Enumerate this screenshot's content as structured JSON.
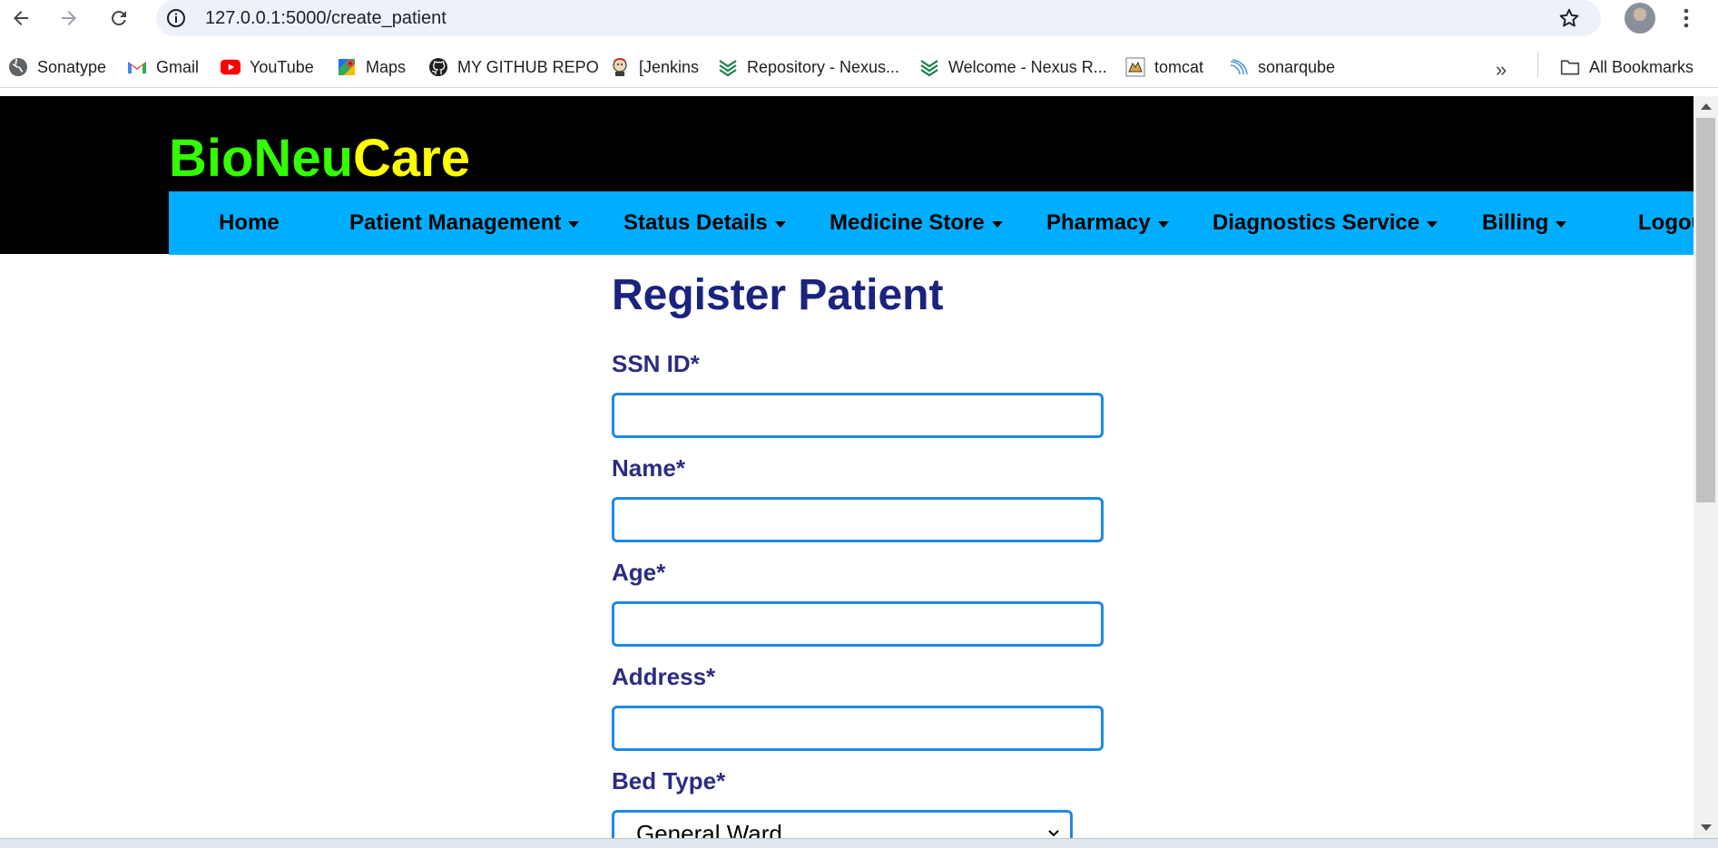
{
  "browser": {
    "url": "127.0.0.1:5000/create_patient",
    "bookmarks": [
      {
        "label": "Sonatype",
        "icon": "globe-icon"
      },
      {
        "label": "Gmail",
        "icon": "gmail-icon"
      },
      {
        "label": "YouTube",
        "icon": "youtube-icon"
      },
      {
        "label": "Maps",
        "icon": "maps-icon"
      },
      {
        "label": "MY GITHUB REPO",
        "icon": "github-icon"
      },
      {
        "label": "[Jenkins",
        "icon": "jenkins-icon"
      },
      {
        "label": "Repository - Nexus...",
        "icon": "nexus-icon"
      },
      {
        "label": "Welcome - Nexus R...",
        "icon": "nexus-icon"
      },
      {
        "label": "tomcat",
        "icon": "tomcat-icon"
      },
      {
        "label": "sonarqube",
        "icon": "sonarqube-icon"
      }
    ],
    "all_bookmarks_label": "All Bookmarks"
  },
  "site": {
    "brand_part1": "BioNeu",
    "brand_part2": "Care",
    "brand_color1": "#33ff00",
    "brand_color2": "#ffff00",
    "menu_color": "#00aeff",
    "nav": [
      {
        "label": "Home",
        "dropdown": false
      },
      {
        "label": "Patient Management",
        "dropdown": true
      },
      {
        "label": "Status Details",
        "dropdown": true
      },
      {
        "label": "Medicine Store",
        "dropdown": true
      },
      {
        "label": "Pharmacy",
        "dropdown": true
      },
      {
        "label": "Diagnostics Service",
        "dropdown": true
      },
      {
        "label": "Billing",
        "dropdown": true
      },
      {
        "label": "Logou",
        "dropdown": false
      }
    ]
  },
  "form": {
    "title": "Register Patient",
    "fields": [
      {
        "label": "SSN ID*",
        "value": ""
      },
      {
        "label": "Name*",
        "value": ""
      },
      {
        "label": "Age*",
        "value": ""
      },
      {
        "label": "Address*",
        "value": ""
      }
    ],
    "bed_type": {
      "label": "Bed Type*",
      "selected": "General Ward"
    }
  }
}
